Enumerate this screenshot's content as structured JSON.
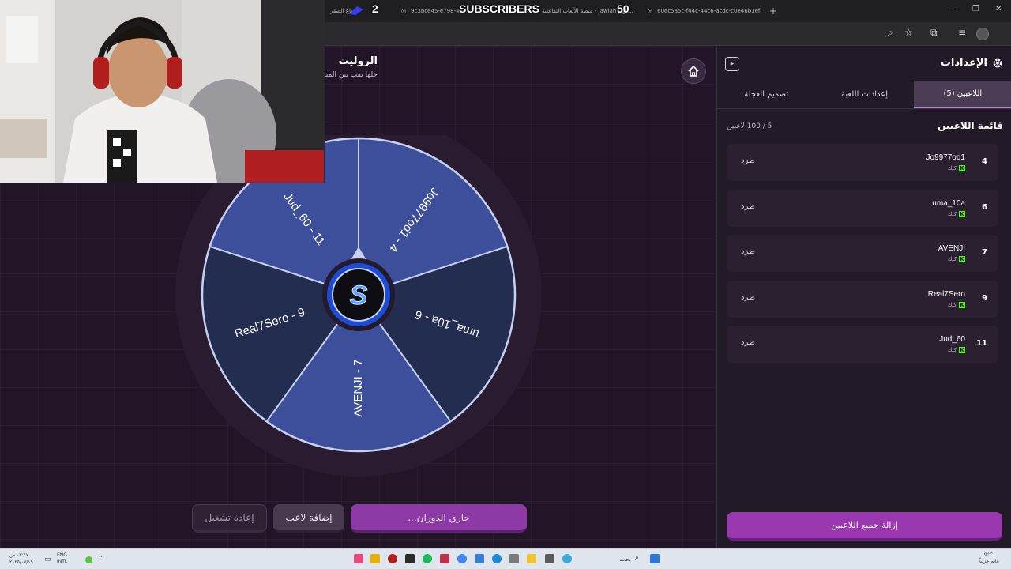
{
  "browser": {
    "tabs": [
      {
        "title": "جماع الصقر"
      },
      {
        "title": "9c3bce45-e798-49c4-b..."
      },
      {
        "title": "منصة الألعاب التفاعلية - Jawlah | الع..."
      },
      {
        "title": "60ec5a5c-f44c-44c6-acdc-c0e46b1ef4b8"
      }
    ],
    "new_tab": "+",
    "overlay": {
      "left_count": "2",
      "label": "SUBSCRIBERS",
      "right_count": "50"
    }
  },
  "header": {
    "title": "الروليت",
    "subtitle": "خلها تقب بين المتابعين في الشات"
  },
  "wheel": {
    "segments": [
      {
        "label": "Jo9977od1 - 4"
      },
      {
        "label": "uma_10a - 6"
      },
      {
        "label": "AVENJI - 7"
      },
      {
        "label": "Real7Sero - 9"
      },
      {
        "label": "Jud_60 - 11"
      }
    ],
    "colors": {
      "light": "#3d4f9a",
      "dark": "#232d4f",
      "stroke": "#c7d0f0"
    }
  },
  "actions": {
    "spin": "جاري الدوران...",
    "add_player": "إضافة لاعب",
    "reset": "إعادة تشغيل"
  },
  "sidebar": {
    "title": "الإعدادات",
    "tabs": [
      {
        "label": "اللاعبين (5)",
        "active": true
      },
      {
        "label": "إعدادات اللعبة",
        "active": false
      },
      {
        "label": "تصميم العجلة",
        "active": false
      }
    ],
    "list_title": "قائمة اللاعبين",
    "list_count": "5 / 100 لاعبين",
    "players": [
      {
        "num": "4",
        "name": "Jo9977od1",
        "platform": "كيك",
        "action": "طرد"
      },
      {
        "num": "6",
        "name": "uma_10a",
        "platform": "كيك",
        "action": "طرد"
      },
      {
        "num": "7",
        "name": "AVENJI",
        "platform": "كيك",
        "action": "طرد"
      },
      {
        "num": "9",
        "name": "Real7Sero",
        "platform": "كيك",
        "action": "طرد"
      },
      {
        "num": "11",
        "name": "Jud_60",
        "platform": "كيك",
        "action": "طرد"
      }
    ],
    "remove_all": "إزالة جميع اللاعبين"
  },
  "taskbar": {
    "time": "٠٣:٤٧ ص",
    "date": "٢٠٢٥/٠٧/١٩",
    "lang": "ENG",
    "lang2": "INTL",
    "search": "بحث",
    "weather_temp": "9°C",
    "weather_desc": "غائم جزئياً"
  }
}
